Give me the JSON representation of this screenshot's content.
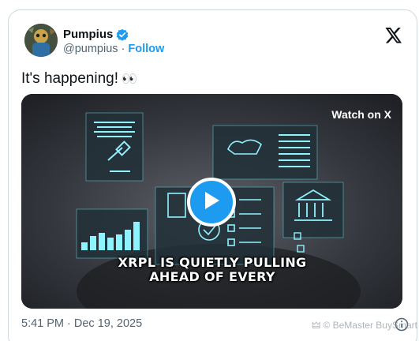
{
  "author": {
    "display_name": "Pumpius",
    "handle": "@pumpius",
    "separator": "·",
    "follow_label": "Follow"
  },
  "tweet": {
    "text": "It's happening!",
    "emoji": "👀"
  },
  "video": {
    "watch_label": "Watch on X",
    "caption_line1": "XRPL IS QUIETLY PULLING",
    "caption_line2": "AHEAD OF EVERY"
  },
  "footer": {
    "timestamp": "5:41 PM · Dec 19, 2025"
  },
  "watermark": "🜲 © BeMaster BuySmart",
  "icons": [
    "verified-badge-icon",
    "x-logo-icon",
    "play-icon",
    "info-icon"
  ],
  "colors": {
    "accent": "#1d9bf0",
    "text": "#0f1419",
    "muted": "#536471",
    "border": "#cfd9de"
  }
}
